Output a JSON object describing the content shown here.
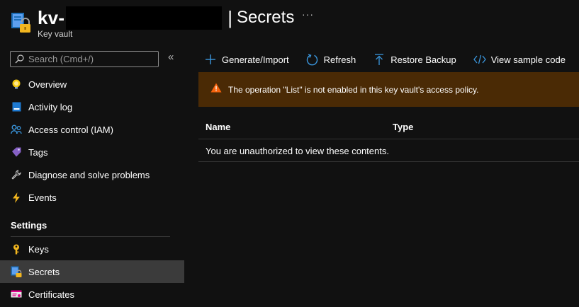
{
  "header": {
    "title_prefix": "kv-",
    "separator": "|",
    "page_title": "Secrets",
    "more": "···",
    "subtitle": "Key vault"
  },
  "sidebar": {
    "search_placeholder": "Search (Cmd+/)",
    "collapse": "«",
    "items": [
      {
        "label": "Overview",
        "icon": "lightbulb-icon"
      },
      {
        "label": "Activity log",
        "icon": "activity-log-icon"
      },
      {
        "label": "Access control (IAM)",
        "icon": "people-icon"
      },
      {
        "label": "Tags",
        "icon": "tag-icon"
      },
      {
        "label": "Diagnose and solve problems",
        "icon": "wrench-icon"
      },
      {
        "label": "Events",
        "icon": "lightning-icon"
      }
    ],
    "settings_header": "Settings",
    "settings_items": [
      {
        "label": "Keys",
        "icon": "key-icon"
      },
      {
        "label": "Secrets",
        "icon": "secrets-icon",
        "active": true
      },
      {
        "label": "Certificates",
        "icon": "certificate-icon"
      }
    ]
  },
  "toolbar": {
    "generate": "Generate/Import",
    "refresh": "Refresh",
    "restore": "Restore Backup",
    "sample": "View sample code"
  },
  "warning": {
    "text": "The operation \"List\" is not enabled in this key vault's access policy.",
    "icon": "warning-icon"
  },
  "table": {
    "columns": [
      "Name",
      "Type"
    ],
    "empty_message": "You are unauthorized to view these contents."
  },
  "colors": {
    "background": "#111111",
    "accent": "#3a96dd",
    "warning_bg": "#4a2a05",
    "warning_icon": "#f7630c",
    "active_item": "#3b3b3b"
  }
}
